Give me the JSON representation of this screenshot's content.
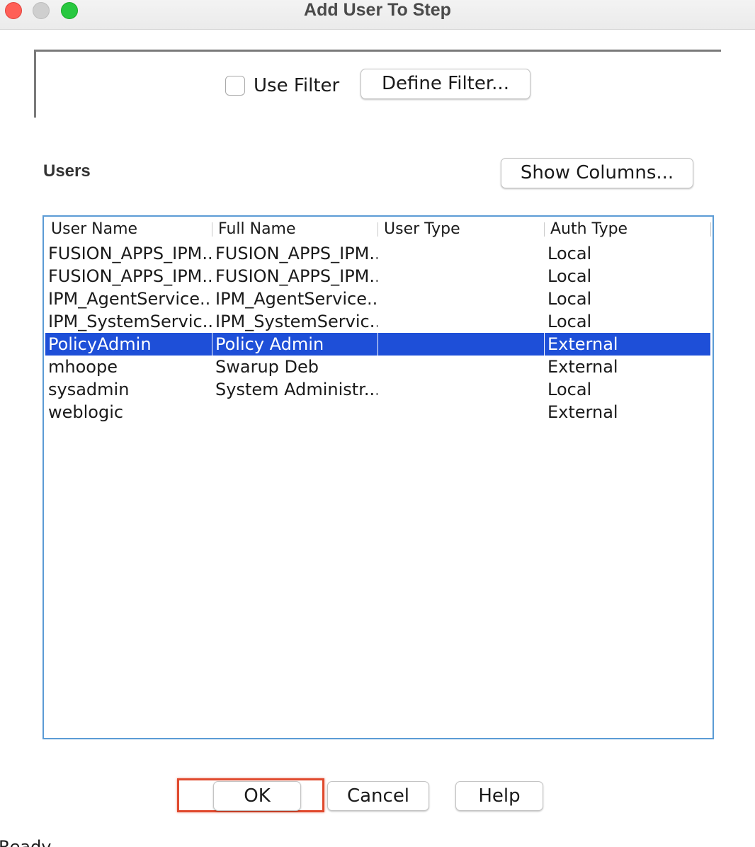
{
  "window": {
    "title": "Add User To Step"
  },
  "filter": {
    "use_filter_label": "Use Filter",
    "use_filter_checked": false,
    "define_filter_label": "Define Filter..."
  },
  "users": {
    "section_label": "Users",
    "show_columns_label": "Show Columns...",
    "columns": [
      "User Name",
      "Full Name",
      "User Type",
      "Auth Type"
    ],
    "rows": [
      {
        "user_name": "FUSION_APPS_IPM...",
        "full_name": "FUSION_APPS_IPM...",
        "user_type": "",
        "auth_type": "Local",
        "selected": false
      },
      {
        "user_name": "FUSION_APPS_IPM...",
        "full_name": "FUSION_APPS_IPM...",
        "user_type": "",
        "auth_type": "Local",
        "selected": false
      },
      {
        "user_name": "IPM_AgentService...",
        "full_name": "IPM_AgentService...",
        "user_type": "",
        "auth_type": "Local",
        "selected": false
      },
      {
        "user_name": "IPM_SystemServic...",
        "full_name": "IPM_SystemServic...",
        "user_type": "",
        "auth_type": "Local",
        "selected": false
      },
      {
        "user_name": "PolicyAdmin",
        "full_name": "Policy Admin",
        "user_type": "",
        "auth_type": "External",
        "selected": true
      },
      {
        "user_name": "mhoope",
        "full_name": "Swarup Deb",
        "user_type": "",
        "auth_type": "External",
        "selected": false
      },
      {
        "user_name": "sysadmin",
        "full_name": "System Administr...",
        "user_type": "",
        "auth_type": "Local",
        "selected": false
      },
      {
        "user_name": "weblogic",
        "full_name": "",
        "user_type": "",
        "auth_type": "External",
        "selected": false
      }
    ]
  },
  "buttons": {
    "ok_label": "OK",
    "cancel_label": "Cancel",
    "help_label": "Help"
  },
  "status_bar": {
    "text": "Ready"
  },
  "colors": {
    "selection": "#1e4fd8",
    "table_border": "#5b9bd5",
    "highlight_box": "#e04a2e"
  }
}
